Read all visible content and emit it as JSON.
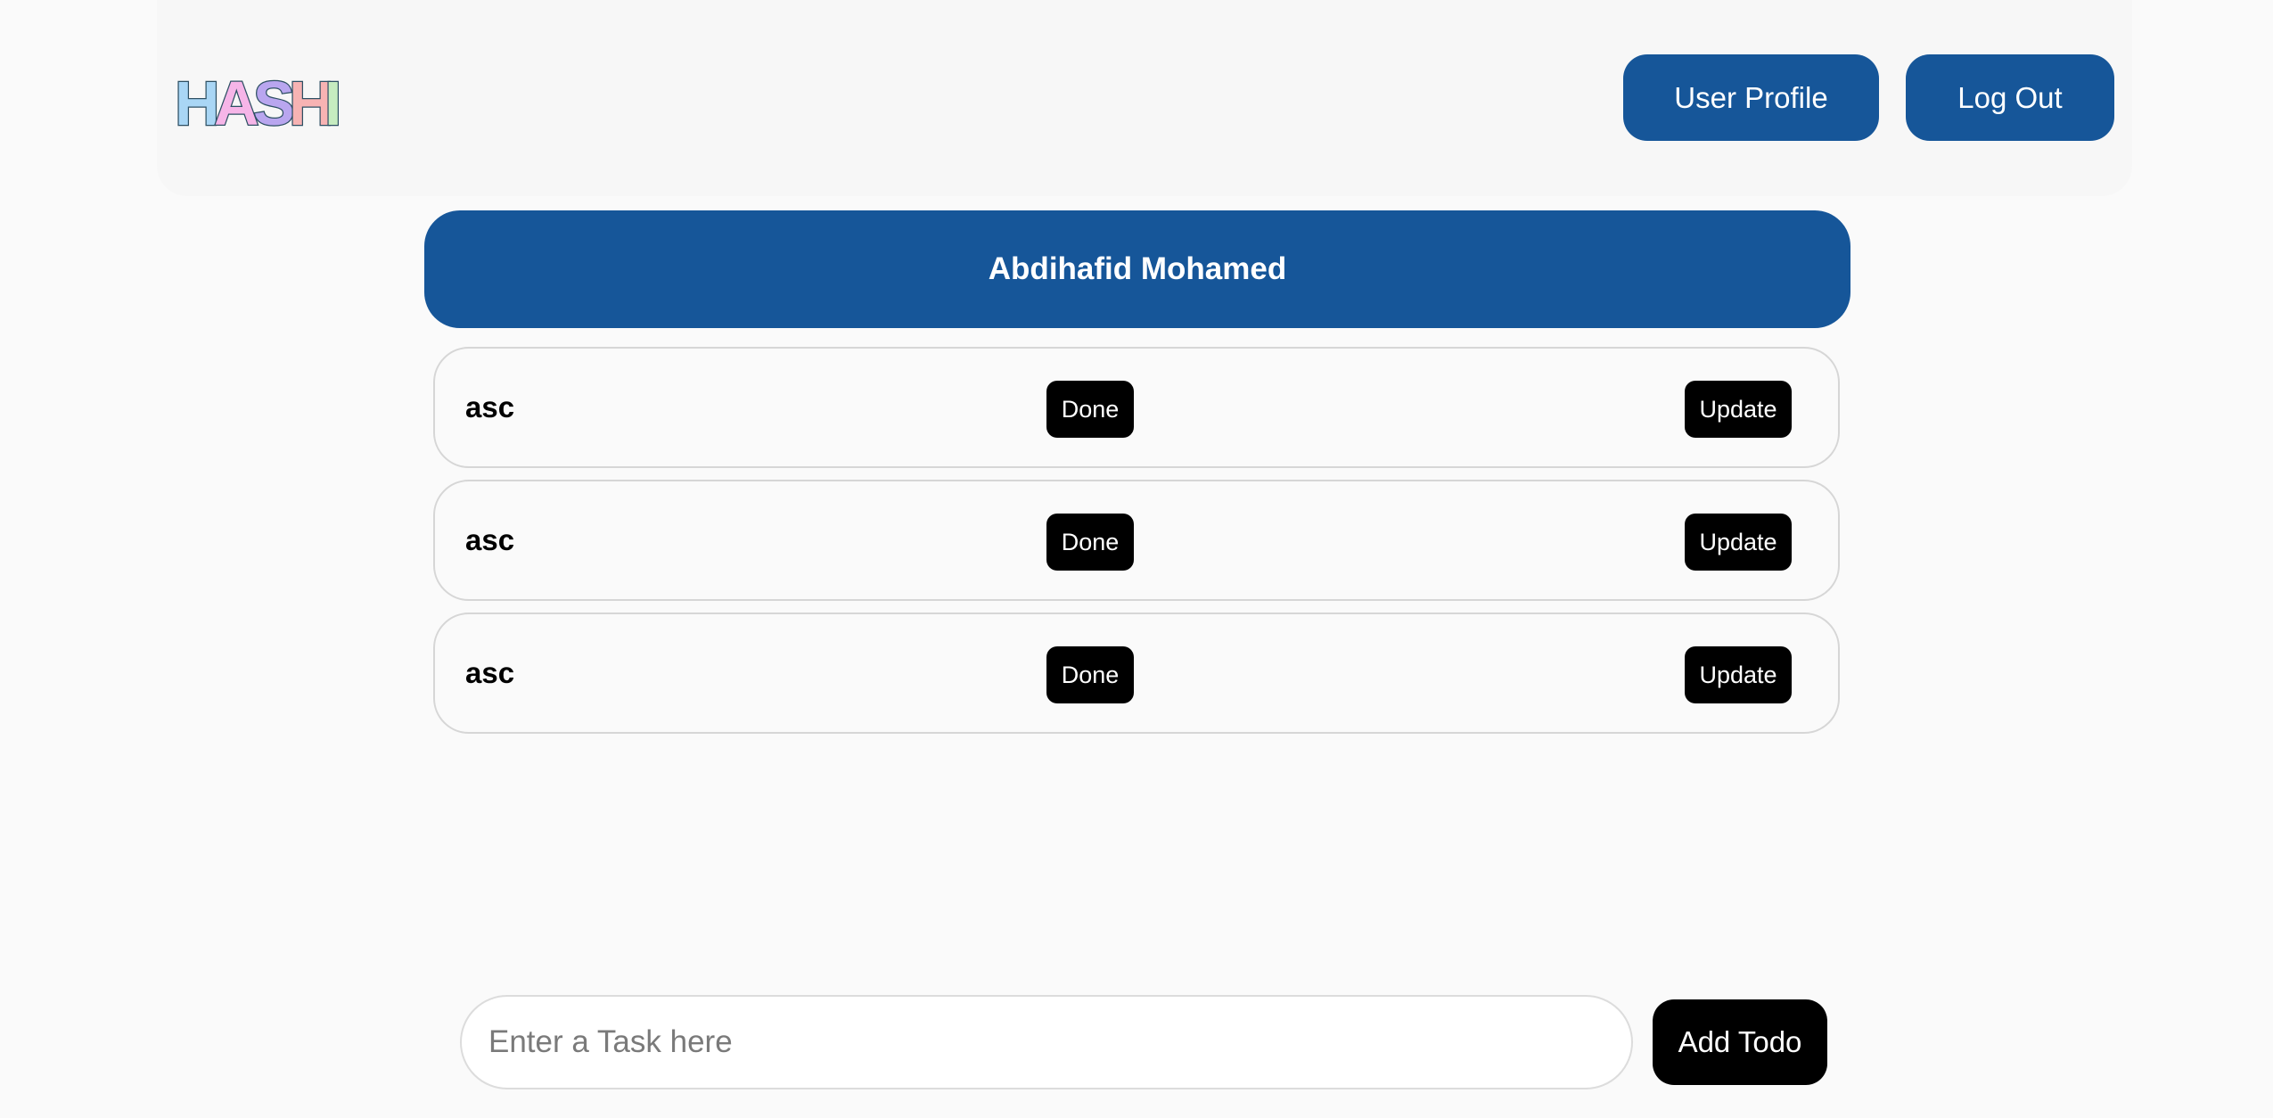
{
  "header": {
    "logo_text": "HASHI",
    "logo_colors": [
      "#a9d6f5",
      "#f6b5e8",
      "#b9a6ef",
      "#f7b3b3",
      "#c6ecc0"
    ],
    "user_profile_label": "User Profile",
    "logout_label": "Log Out"
  },
  "user": {
    "name": "Abdihafid Mohamed"
  },
  "todos": [
    {
      "text": "asc",
      "done_label": "Done",
      "update_label": "Update"
    },
    {
      "text": "asc",
      "done_label": "Done",
      "update_label": "Update"
    },
    {
      "text": "asc",
      "done_label": "Done",
      "update_label": "Update"
    }
  ],
  "new_task": {
    "placeholder": "Enter a Task here",
    "value": "",
    "add_label": "Add Todo"
  },
  "colors": {
    "primary": "#165699",
    "background": "#fafafa",
    "button_dark": "#000000"
  }
}
